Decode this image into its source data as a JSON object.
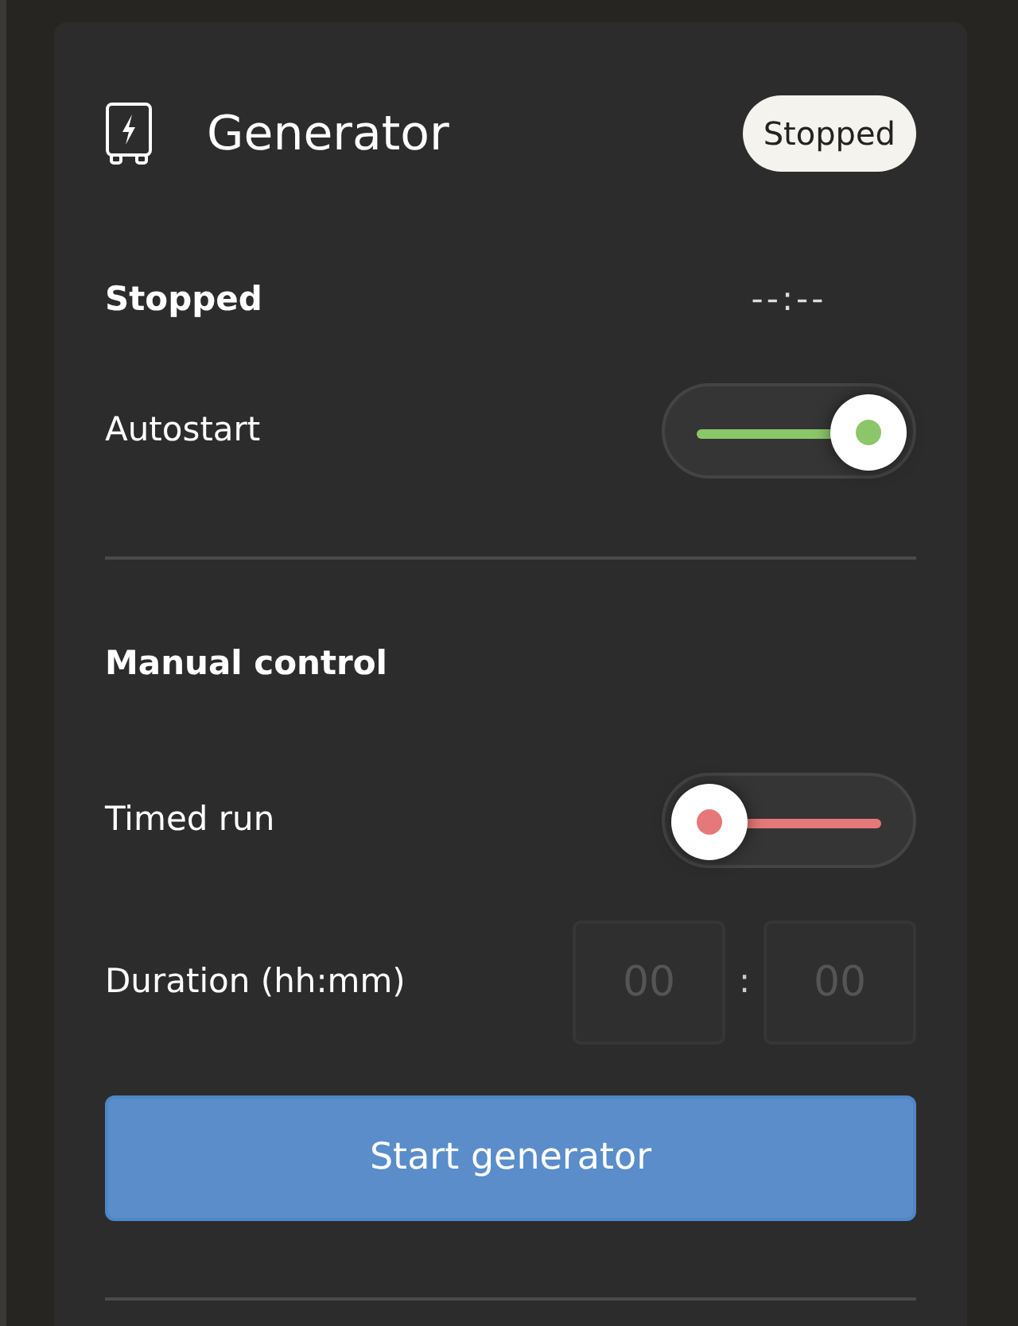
{
  "card": {
    "title": "Generator",
    "badge": "Stopped"
  },
  "status": {
    "label": "Stopped",
    "time": "--:--"
  },
  "autostart": {
    "label": "Autostart",
    "on": true
  },
  "manual": {
    "heading": "Manual control",
    "timed_run": {
      "label": "Timed run",
      "on": false
    },
    "duration": {
      "label": "Duration (hh:mm)",
      "hours_placeholder": "00",
      "separator": ":",
      "minutes_placeholder": "00"
    },
    "button": "Start generator"
  }
}
